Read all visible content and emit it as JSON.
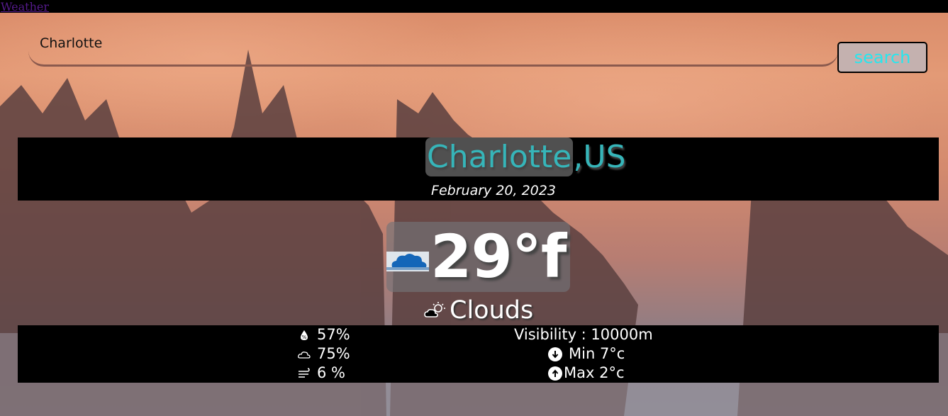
{
  "nav": {
    "link_label": "Weather"
  },
  "search": {
    "value": "Charlotte",
    "button_label": "search"
  },
  "location": {
    "city": "Charlotte",
    "country": ",US",
    "date": "February 20, 2023"
  },
  "current": {
    "temperature": "29°f",
    "condition": "Clouds",
    "icon": "clouds-icon",
    "condition_icon": "cloudy-sun-icon"
  },
  "details": {
    "humidity": "57%",
    "cloudiness": "75%",
    "wind": "6 %",
    "visibility": "Visibility : 10000m",
    "min": "Min 7°c",
    "max": "Max 2°c"
  },
  "colors": {
    "accent": "#36b5b9",
    "button_text": "#27e6ee",
    "band": "#000000"
  }
}
